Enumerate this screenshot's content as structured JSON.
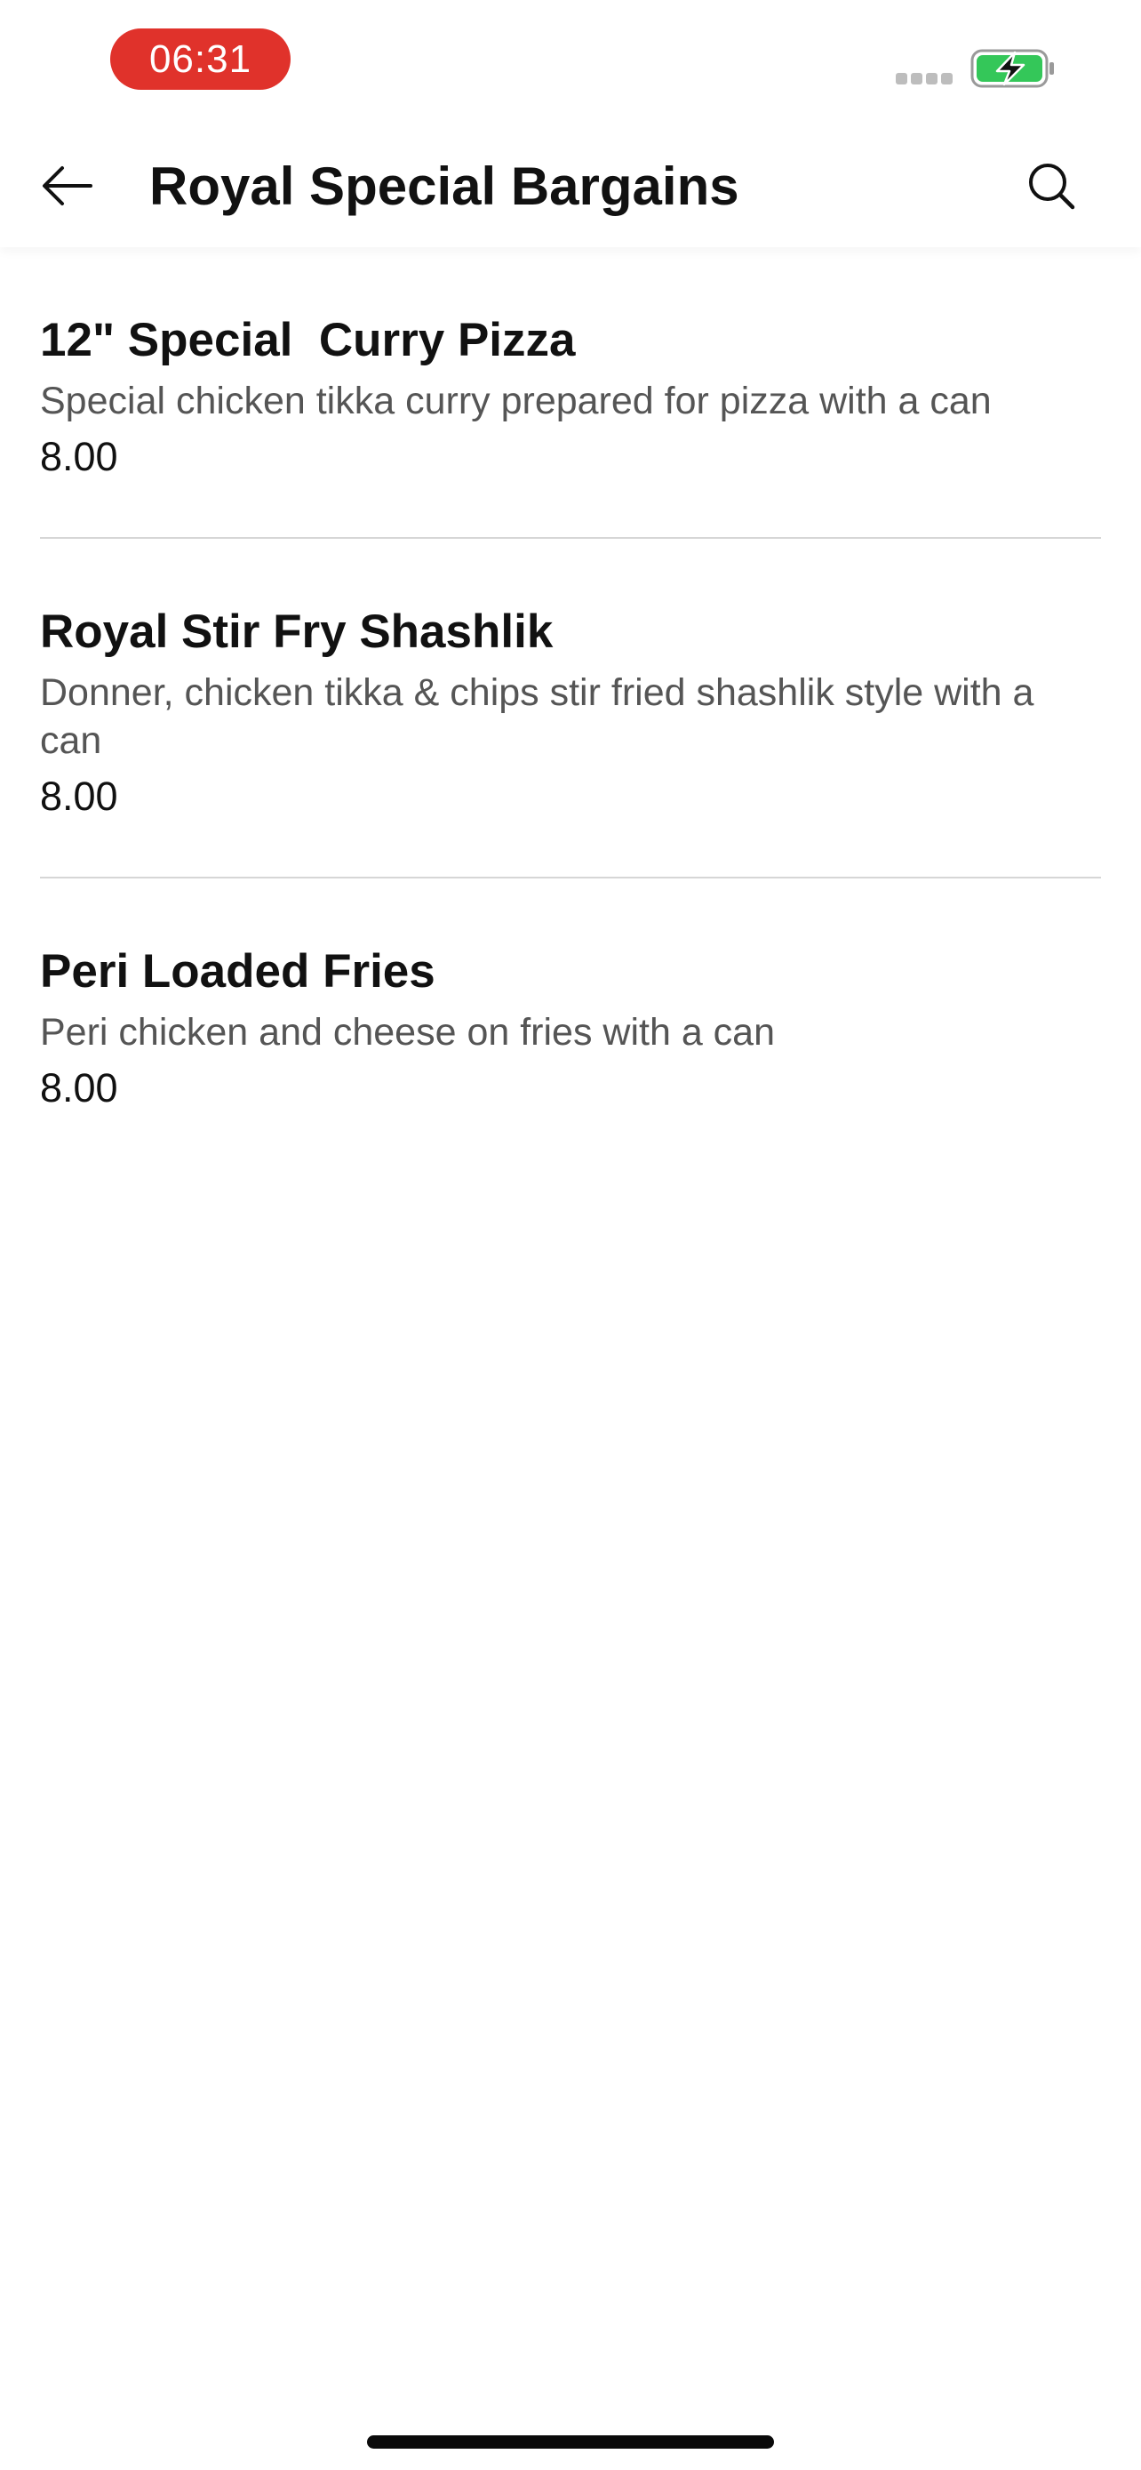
{
  "status_bar": {
    "time": "06:31",
    "time_pill_color": "#e0322b",
    "battery_icon": "battery-charging-icon",
    "battery_color": "#34c759",
    "signal_icon": "cellular-signal-icon"
  },
  "header": {
    "title": "Royal Special Bargains",
    "back_icon": "arrow-left-icon",
    "search_icon": "search-icon"
  },
  "menu": {
    "items": [
      {
        "name": "12\" Special  Curry Pizza",
        "description": "Special chicken tikka curry prepared for pizza with a can",
        "price": "8.00"
      },
      {
        "name": "Royal Stir Fry Shashlik",
        "description": "Donner, chicken tikka & chips stir fried shashlik style with a can",
        "price": "8.00"
      },
      {
        "name": "Peri Loaded Fries",
        "description": "Peri chicken and cheese on fries with a can",
        "price": "8.00"
      }
    ]
  }
}
